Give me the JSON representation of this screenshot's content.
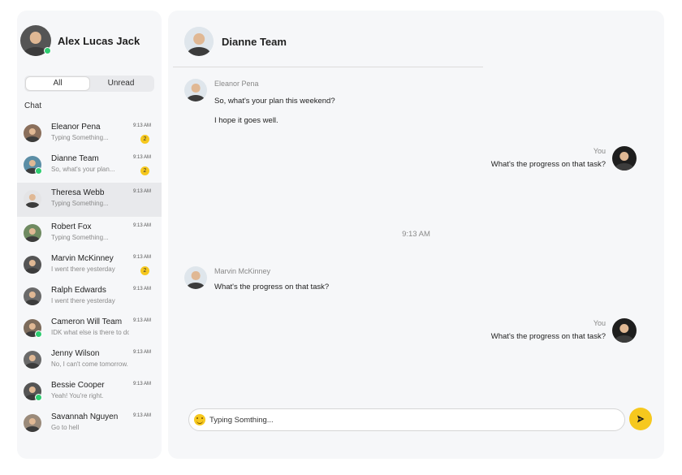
{
  "user": {
    "name": "Alex Lucas Jack",
    "online": true
  },
  "filters": {
    "all_label": "All",
    "unread_label": "Unread",
    "active": "All"
  },
  "sidebar": {
    "section_label": "Chat",
    "chats": [
      {
        "name": "Eleanor Pena",
        "preview": "Typing Something...",
        "time": "9:13 AM",
        "unread": "2",
        "online": false
      },
      {
        "name": "Dianne Team",
        "preview": "So, what's your plan...",
        "time": "9:13 AM",
        "unread": "2",
        "online": true
      },
      {
        "name": "Theresa Webb",
        "preview": "Typing Something...",
        "time": "9:13 AM",
        "unread": "",
        "online": false,
        "selected": true
      },
      {
        "name": "Robert Fox",
        "preview": "Typing Something...",
        "time": "9:13 AM",
        "unread": "",
        "online": false
      },
      {
        "name": "Marvin McKinney",
        "preview": "I went there yesterday",
        "time": "9:13 AM",
        "unread": "2",
        "online": false
      },
      {
        "name": "Ralph Edwards",
        "preview": "I went there yesterday",
        "time": "9:13 AM",
        "unread": "",
        "online": false
      },
      {
        "name": "Cameron Will Team",
        "preview": "IDK what else is there to do",
        "time": "9:13 AM",
        "unread": "",
        "online": true
      },
      {
        "name": "Jenny Wilson",
        "preview": "No, I can't come tomorrow.",
        "time": "9:13 AM",
        "unread": "",
        "online": false
      },
      {
        "name": "Bessie Cooper",
        "preview": "Yeah! You're right.",
        "time": "9:13 AM",
        "unread": "",
        "online": true
      },
      {
        "name": "Savannah Nguyen",
        "preview": "Go to hell",
        "time": "9:13 AM",
        "unread": "",
        "online": false
      }
    ]
  },
  "conversation": {
    "title": "Dianne Team",
    "messages": [
      {
        "sender": "Eleanor Pena",
        "lines": [
          "So, what's your plan this weekend?",
          "I hope it goes well."
        ]
      },
      {
        "sender": "You",
        "lines": [
          "What's the progress on that task?"
        ]
      },
      {
        "sender": "Marvin McKinney",
        "lines": [
          "What's the progress on that task?"
        ]
      },
      {
        "sender": "You",
        "lines": [
          "What's the progress on that task?"
        ]
      }
    ],
    "time_separator": "9:13 AM"
  },
  "composer": {
    "value": "Typing Somthing...",
    "placeholder": ""
  },
  "icons": {
    "emoji": "smile-emoji-icon",
    "send": "send-arrow-icon"
  },
  "colors": {
    "accent": "#f6c81e",
    "online": "#2ecc71",
    "panel": "#f6f7f9",
    "selected_row": "#e8e9ec"
  }
}
